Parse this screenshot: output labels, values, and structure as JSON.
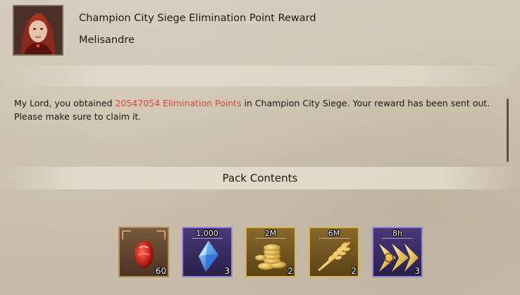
{
  "mail": {
    "title": "Champion City Siege Elimination Point Reward",
    "sender": "Melisandre",
    "avatar_icon": "portrait-red-haired-woman"
  },
  "message": {
    "before": "My Lord, you obtained ",
    "highlight": "20547054 Elimination Points",
    "after": " in Champion City Siege. Your reward has been sent out. Please make sure to claim it.",
    "highlight_color": "#e0463a"
  },
  "pack": {
    "header": "Pack Contents",
    "items": [
      {
        "icon": "dragon-heart-gem-icon",
        "amount": "",
        "count": "60",
        "frame": "bronze"
      },
      {
        "icon": "blue-crystal-icon",
        "amount": "1,000",
        "count": "3",
        "frame": "purple"
      },
      {
        "icon": "gold-coins-icon",
        "amount": "2M",
        "count": "2",
        "frame": "gold"
      },
      {
        "icon": "wheat-icon",
        "amount": "6M",
        "count": "2",
        "frame": "gold"
      },
      {
        "icon": "speedup-arrow-icon",
        "amount": "8h",
        "count": "3",
        "frame": "purple"
      }
    ]
  }
}
